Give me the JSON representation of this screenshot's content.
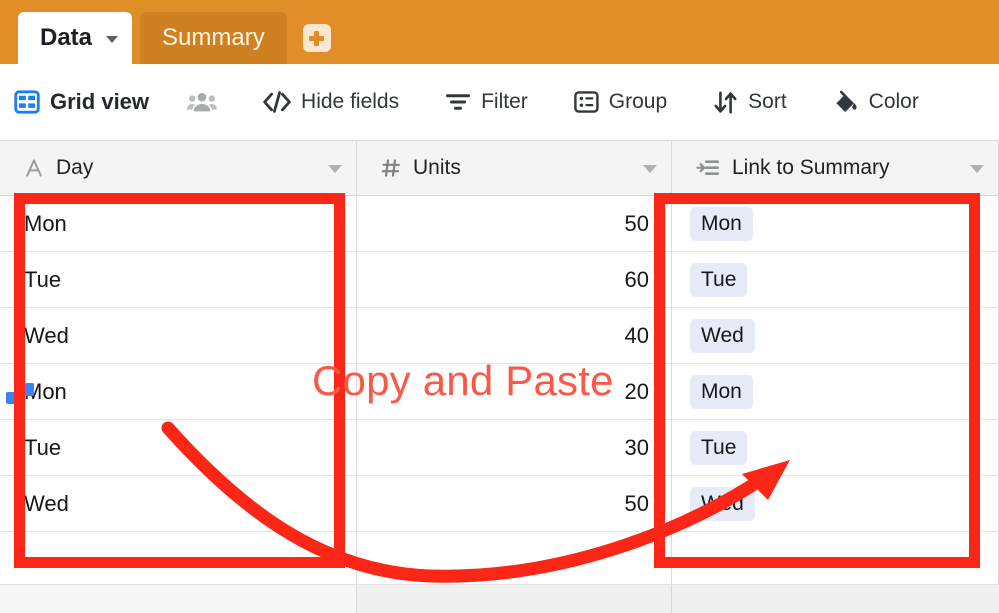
{
  "tabs": {
    "items": [
      {
        "label": "Data",
        "active": true,
        "has_caret": true
      },
      {
        "label": "Summary",
        "active": false,
        "has_caret": false
      }
    ],
    "add_tab_icon": "plus-icon",
    "bar_color": "#df8e28",
    "inactive_tab_color": "#cf8122",
    "add_button_color": "#fae7cf"
  },
  "toolbar": {
    "view_icon": "grid-view-icon",
    "view_name": "Grid view",
    "collaborators_icon": "people-icon",
    "buttons": [
      {
        "label": "Hide fields",
        "icon": "code-slash-icon"
      },
      {
        "label": "Filter",
        "icon": "funnel-icon"
      },
      {
        "label": "Group",
        "icon": "group-list-icon"
      },
      {
        "label": "Sort",
        "icon": "sort-arrows-icon"
      },
      {
        "label": "Color",
        "icon": "paint-bucket-icon"
      }
    ]
  },
  "grid": {
    "columns": [
      {
        "name": "Day",
        "type_icon": "text-type-icon",
        "caret": "chevron-down-icon"
      },
      {
        "name": "Units",
        "type_icon": "number-type-icon",
        "caret": "chevron-down-icon"
      },
      {
        "name": "Link to Summary",
        "type_icon": "link-record-icon",
        "caret": "chevron-down-icon"
      }
    ],
    "rows": [
      {
        "day": "Mon",
        "units": "50",
        "link": "Mon"
      },
      {
        "day": "Tue",
        "units": "60",
        "link": "Tue"
      },
      {
        "day": "Wed",
        "units": "40",
        "link": "Wed"
      },
      {
        "day": "Mon",
        "units": "20",
        "link": "Mon"
      },
      {
        "day": "Tue",
        "units": "30",
        "link": "Tue"
      },
      {
        "day": "Wed",
        "units": "50",
        "link": "Wed"
      }
    ],
    "empty_row": {
      "day": "",
      "units": "",
      "link": ""
    },
    "chip_bg": "#e7eaf7"
  },
  "annotation": {
    "text": "Copy and Paste",
    "text_color": "#fb5847",
    "box_color": "#fb2616",
    "arrow_icon": "curved-arrow-icon",
    "source_box_label": "Day column selection",
    "target_box_label": "Link to Summary column selection"
  }
}
